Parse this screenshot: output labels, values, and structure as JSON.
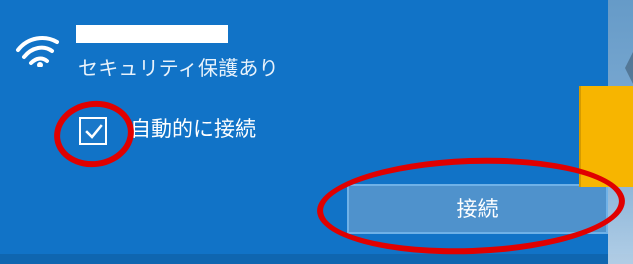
{
  "network": {
    "status": "セキュリティ保護あり",
    "auto_connect_label": "自動的に接続",
    "auto_connect_checked": true,
    "connect_button_label": "接続"
  },
  "icons": {
    "wifi": "wifi-icon",
    "checkbox": "checkbox-checked-icon"
  },
  "colors": {
    "panel": "#1173c7",
    "button": "#4f92cc",
    "annotation": "#e00000",
    "side_card": "#f7b500"
  }
}
